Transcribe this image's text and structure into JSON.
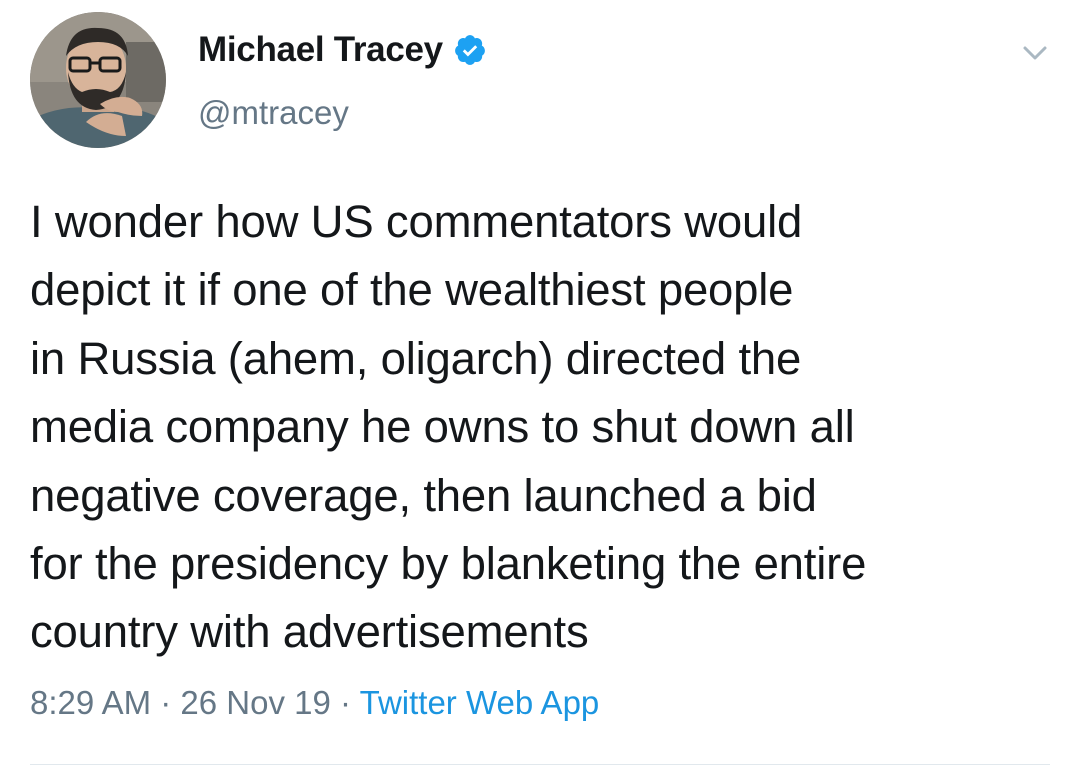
{
  "author": {
    "display_name": "Michael Tracey",
    "handle": "@mtracey",
    "verified": true,
    "avatar_icon": "profile-photo-man-with-glasses-and-beard"
  },
  "tweet": {
    "text": "I wonder how US commentators would\ndepict it if one of the wealthiest people\nin Russia (ahem, oligarch) directed the\nmedia company he owns to shut down all\nnegative coverage, then launched a bid\nfor the presidency by blanketing the entire\ncountry with advertisements",
    "time": "8:29 AM",
    "date": "26 Nov 19",
    "separator": "·",
    "source": "Twitter Web App"
  },
  "icons": {
    "verified": "verified-badge-icon",
    "menu": "chevron-down-icon"
  },
  "colors": {
    "text": "#14171a",
    "secondary": "#657786",
    "accent": "#1b95e0",
    "divider": "#e1e8ed"
  }
}
